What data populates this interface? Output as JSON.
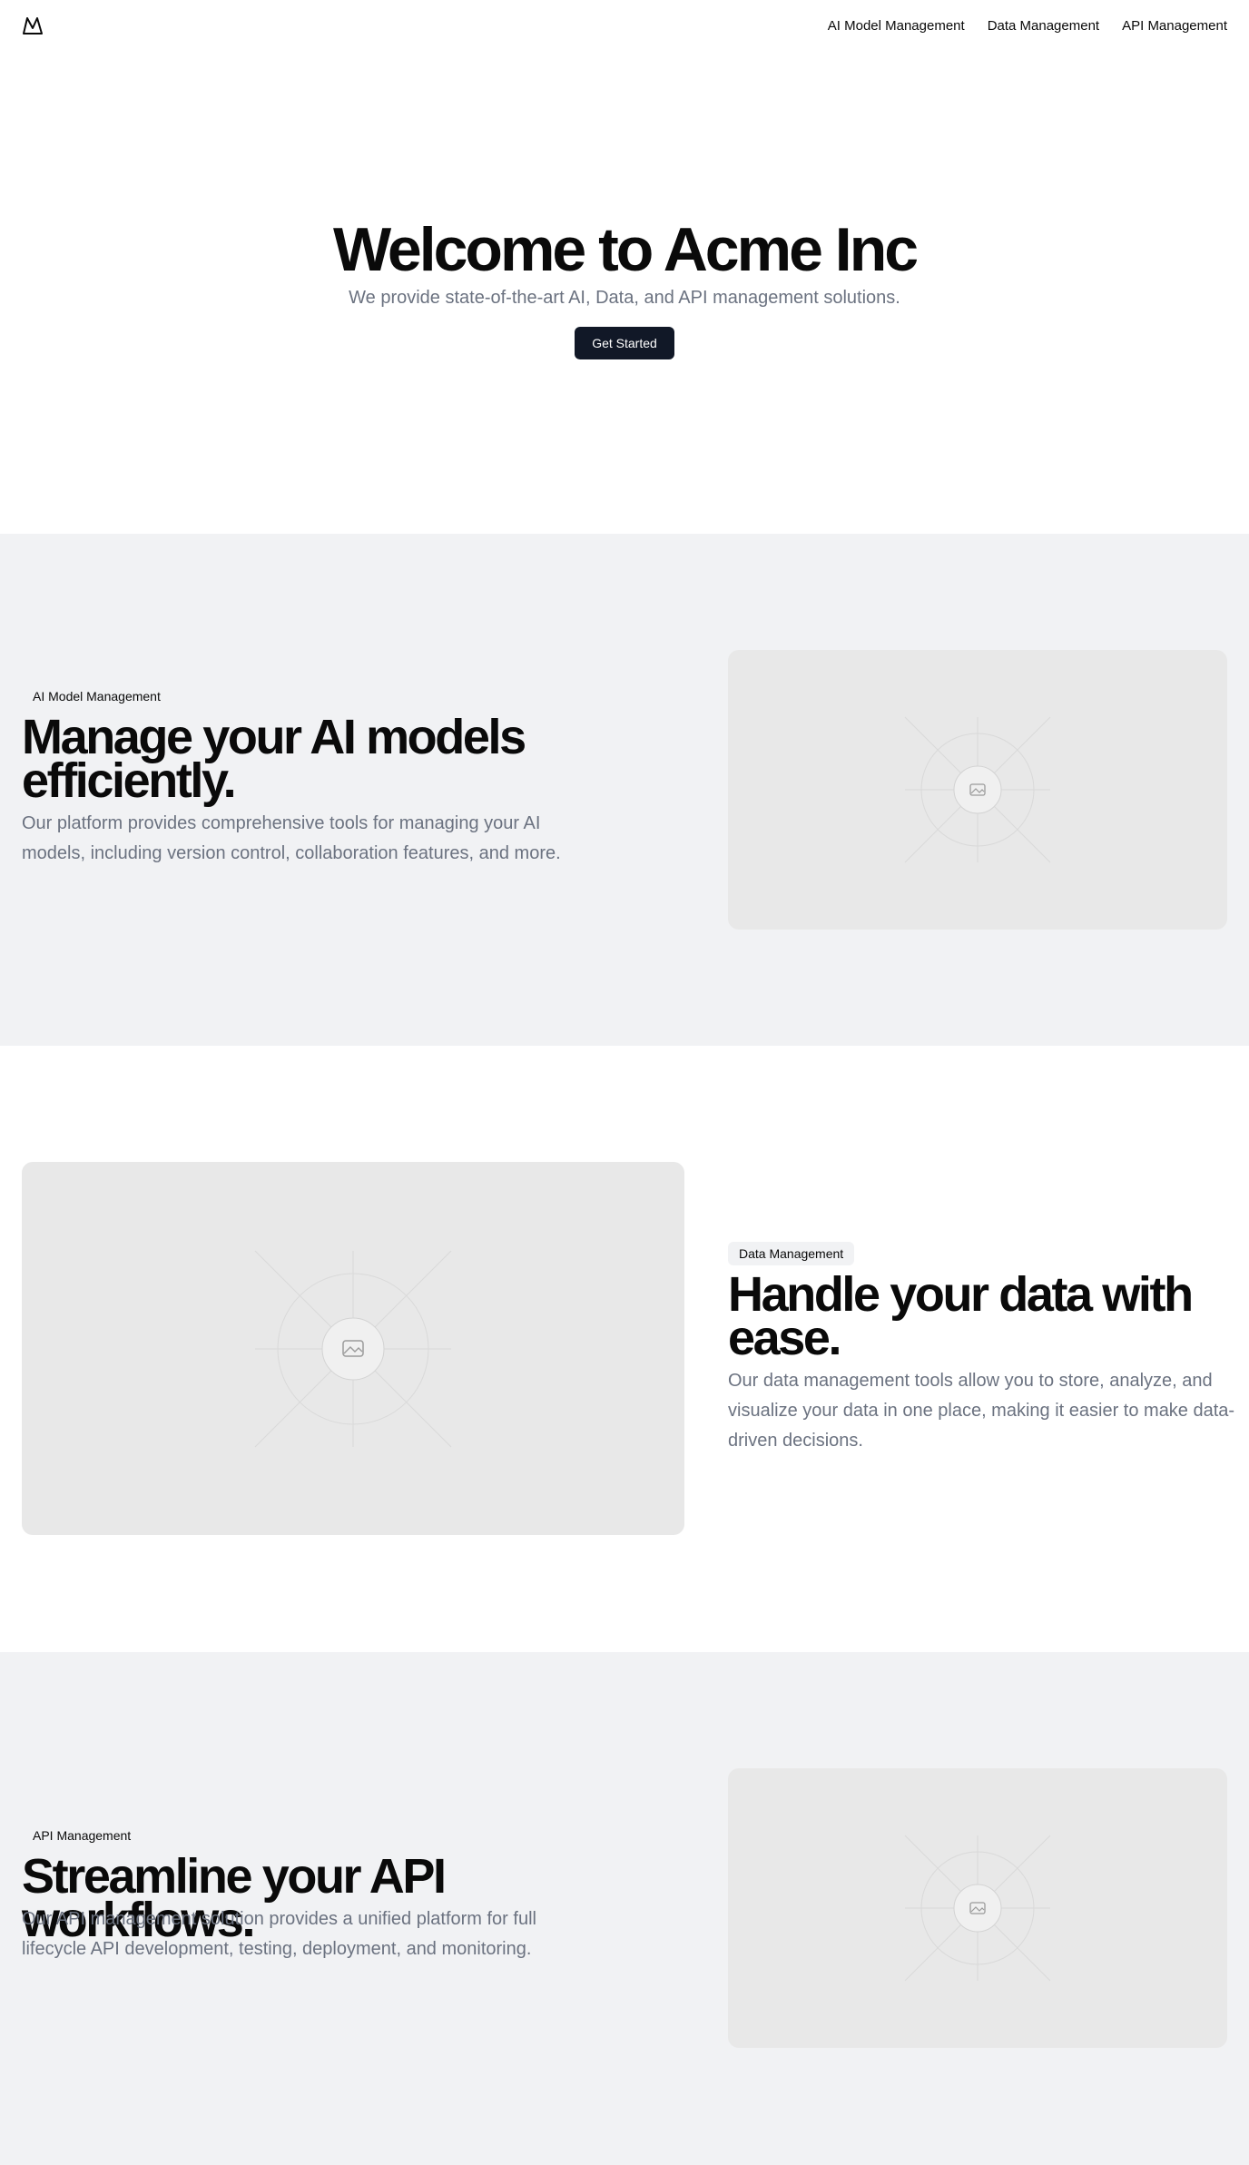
{
  "header": {
    "logo_icon": "mountain-icon",
    "nav": [
      "AI Model Management",
      "Data Management",
      "API Management"
    ]
  },
  "hero": {
    "title": "Welcome to Acme Inc",
    "subtitle": "We provide state-of-the-art AI, Data, and API management solutions.",
    "cta_label": "Get Started"
  },
  "sections": [
    {
      "badge": "AI Model Management",
      "title": "Manage your AI models efficiently.",
      "description": "Our platform provides comprehensive tools for managing your AI models, including version control, collaboration features, and more.",
      "image_icon": "image-placeholder-icon"
    },
    {
      "badge": "Data Management",
      "title": "Handle your data with ease.",
      "description": "Our data management tools allow you to store, analyze, and visualize your data in one place, making it easier to make data-driven decisions.",
      "image_icon": "image-placeholder-icon"
    },
    {
      "badge": "API Management",
      "title": "Streamline your API workflows.",
      "description": "Our API management solution provides a unified platform for full lifecycle API development, testing, deployment, and monitoring.",
      "image_icon": "image-placeholder-icon"
    }
  ],
  "colors": {
    "primary_button": "#111827",
    "muted_text": "#6b7280",
    "section_bg": "#f1f2f4",
    "placeholder_bg": "#e8e8e8"
  }
}
